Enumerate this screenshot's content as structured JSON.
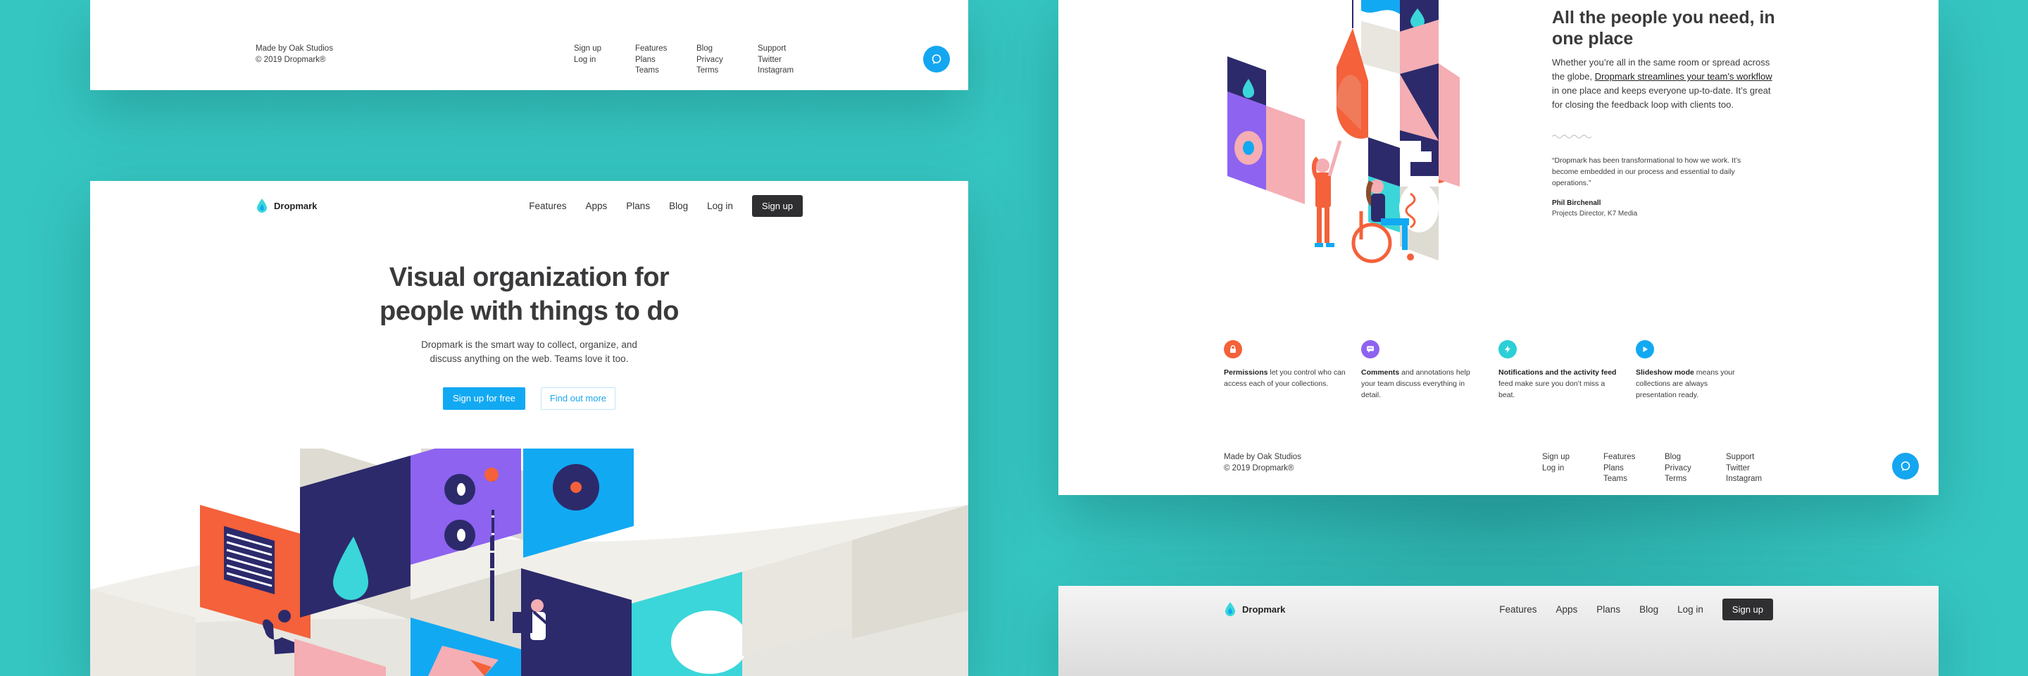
{
  "colors": {
    "background": "#36c6c2",
    "accent": "#12a9f3",
    "dark": "#2f2f31",
    "coral": "#f4613a",
    "navy": "#2c2a6b",
    "violet": "#8d63f0",
    "pink": "#f4aeb4",
    "aqua": "#3ad6d9"
  },
  "footer": {
    "credit_line1": "Made by Oak Studios",
    "credit_line2": "© 2019 Dropmark®",
    "col1": [
      "Sign up",
      "Log in"
    ],
    "col2": [
      "Features",
      "Plans",
      "Teams"
    ],
    "col3": [
      "Blog",
      "Privacy",
      "Terms"
    ],
    "col4": [
      "Support",
      "Twitter",
      "Instagram"
    ]
  },
  "nav": {
    "brand": "Dropmark",
    "links": [
      "Features",
      "Apps",
      "Plans",
      "Blog",
      "Log in"
    ],
    "signup": "Sign up"
  },
  "hero": {
    "title_line1": "Visual organization for",
    "title_line2": "people with things to do",
    "subtitle_line1": "Dropmark is the smart way to collect, organize, and",
    "subtitle_line2": "discuss anything on the web. Teams love it too.",
    "primary_cta": "Sign up for free",
    "secondary_cta": "Find out more"
  },
  "teams_section": {
    "title_line1": "All the people you need, in",
    "title_line2": "one place",
    "body_1": "Whether you’re all in the same room or spread across the globe, ",
    "body_link": "Dropmark streamlines your team’s workflow",
    "body_2": " in one place and keeps everyone up-to-date. It’s great for closing the feedback loop with clients too.",
    "quote": "“Dropmark has been transformational to how we work. It’s become embedded in our process and essential to daily operations.”",
    "quote_author": "Phil Birchenall",
    "quote_role": "Projects Director, K7 Media"
  },
  "features": [
    {
      "icon": "lock-icon",
      "title": "Permissions",
      "text": " let you control who can access each of your collections.",
      "color": "#f4613a"
    },
    {
      "icon": "comment-icon",
      "title": "Comments",
      "text": " and annotations help your team discuss everything in detail.",
      "color": "#8d63f0"
    },
    {
      "icon": "bolt-icon",
      "title": "Notifications and the activity feed",
      "text": " feed make sure you don’t miss a beat.",
      "color": "#2ccfd6"
    },
    {
      "icon": "play-icon",
      "title": "Slideshow mode",
      "text": " means your collections are always presentation ready.",
      "color": "#12a9f3"
    }
  ]
}
